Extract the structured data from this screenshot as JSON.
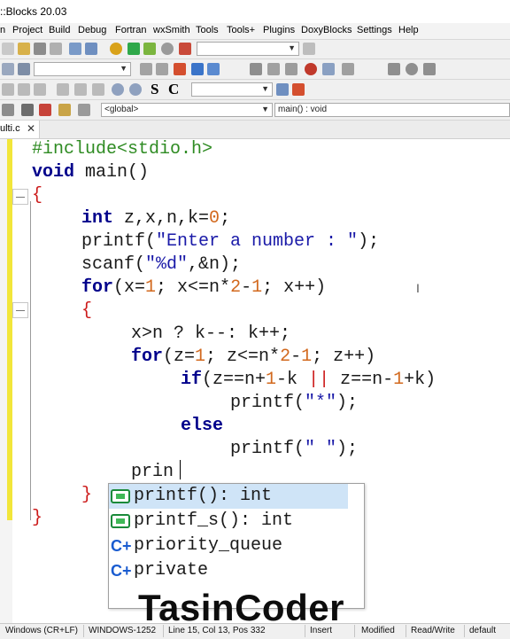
{
  "window": {
    "title": "::Blocks 20.03"
  },
  "menu": [
    "n",
    "Project",
    "Build",
    "Debug",
    "Fortran",
    "wxSmith",
    "Tools",
    "Tools+",
    "Plugins",
    "DoxyBlocks",
    "Settings",
    "Help"
  ],
  "toolbar": {
    "format_buttons": [
      "S",
      "C"
    ],
    "scope_select": "<global>",
    "function_select": "main() : void"
  },
  "tab": {
    "label": "ulti.c",
    "close": "✕"
  },
  "code": {
    "l1": "#include<stdio.h>",
    "l2_kw": "void",
    "l2_rest": " main()",
    "l3": "{",
    "l5_kw": "int",
    "l5_a": " z,x,n,k=",
    "l5_num": "0",
    "l5_end": ";",
    "l6_fn": "printf(",
    "l6_str": "\"Enter a number : \"",
    "l6_end": ");",
    "l7_fn": "scanf(",
    "l7_str": "\"%d\"",
    "l7_end": ",&n);",
    "l8_kw": "for",
    "l8_a": "(x=",
    "l8_n1": "1",
    "l8_b": "; x<=n*",
    "l8_n2": "2",
    "l8_c": "-",
    "l8_n3": "1",
    "l8_d": "; x++)",
    "l9": "{",
    "l10": "x>n ? k--: k++;",
    "l11_kw": "for",
    "l11_a": "(z=",
    "l11_n1": "1",
    "l11_b": "; z<=n*",
    "l11_n2": "2",
    "l11_c": "-",
    "l11_n3": "1",
    "l11_d": "; z++)",
    "l12_kw": "if",
    "l12_a": "(z==n+",
    "l12_n1": "1",
    "l12_b": "-k ",
    "l12_or": "||",
    "l12_c": " z==n-",
    "l12_n2": "1",
    "l12_d": "+k)",
    "l13_fn": "printf(",
    "l13_str": "\"*\"",
    "l13_end": ");",
    "l14_kw": "else",
    "l15_fn": "printf(",
    "l15_str": "\" \"",
    "l15_end": ");",
    "l16": "prin",
    "l17": "}",
    "l18": "}"
  },
  "autocomplete": [
    {
      "icon": "function-icon",
      "text": "printf(): int"
    },
    {
      "icon": "function-icon",
      "text": "printf_s(): int"
    },
    {
      "icon": "class-icon",
      "text": "priority_queue"
    },
    {
      "icon": "class-icon",
      "text": "private"
    }
  ],
  "watermark": "TasinCoder",
  "status": {
    "eol": "Windows (CR+LF)",
    "encoding": "WINDOWS-1252",
    "position": "Line 15, Col 13, Pos 332",
    "mode": "Insert",
    "modified": "Modified",
    "access": "Read/Write",
    "profile": "default"
  }
}
